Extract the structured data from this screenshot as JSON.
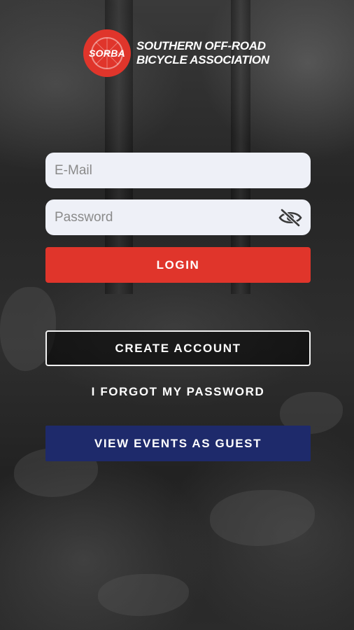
{
  "logo": {
    "badge_text": "SORBA",
    "org_name": "SOUTHERN OFF-ROAD\nBICYCLE ASSOCIATION"
  },
  "form": {
    "email_placeholder": "E-Mail",
    "email_value": "",
    "password_placeholder": "Password",
    "password_value": "",
    "password_toggle_icon": "eye-slash-icon"
  },
  "actions": {
    "login_label": "LOGIN",
    "create_account_label": "CREATE ACCOUNT",
    "forgot_password_label": "I FORGOT MY PASSWORD",
    "guest_label": "VIEW EVENTS AS GUEST"
  },
  "colors": {
    "brand_red": "#e0352b",
    "guest_navy": "#1e2a6b",
    "field_bg": "#eef0f7"
  }
}
